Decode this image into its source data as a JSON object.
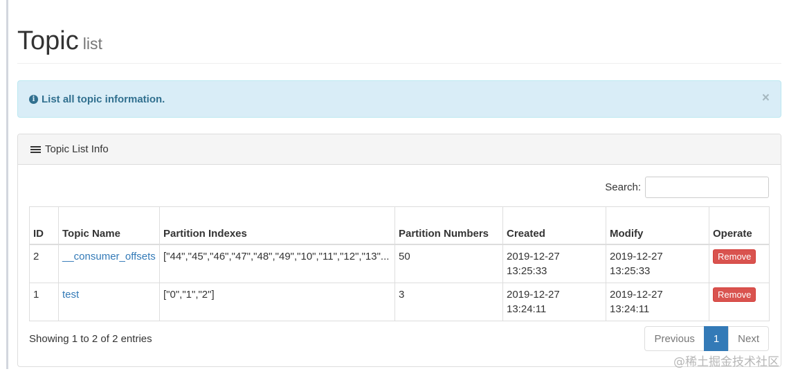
{
  "header": {
    "title": "Topic",
    "subtitle": "list"
  },
  "alert": {
    "message": "List all topic information.",
    "close": "×"
  },
  "panel": {
    "title": "Topic List Info",
    "search_label": "Search:",
    "search_value": "",
    "columns": [
      "ID",
      "Topic Name",
      "Partition Indexes",
      "Partition Numbers",
      "Created",
      "Modify",
      "Operate"
    ],
    "rows": [
      {
        "id": "2",
        "topic_name": "__consumer_offsets",
        "partition_indexes": "[\"44\",\"45\",\"46\",\"47\",\"48\",\"49\",\"10\",\"11\",\"12\",\"13\"...",
        "partition_numbers": "50",
        "created": "2019-12-27 13:25:33",
        "modify": "2019-12-27 13:25:33",
        "operate": "Remove"
      },
      {
        "id": "1",
        "topic_name": "test",
        "partition_indexes": "[\"0\",\"1\",\"2\"]",
        "partition_numbers": "3",
        "created": "2019-12-27 13:24:11",
        "modify": "2019-12-27 13:24:11",
        "operate": "Remove"
      }
    ],
    "info": "Showing 1 to 2 of 2 entries",
    "pagination": {
      "previous": "Previous",
      "page": "1",
      "next": "Next"
    }
  },
  "watermark": "@稀土掘金技术社区",
  "colors": {
    "primary": "#337ab7",
    "danger": "#d9534f",
    "info_bg": "#d9edf7"
  }
}
